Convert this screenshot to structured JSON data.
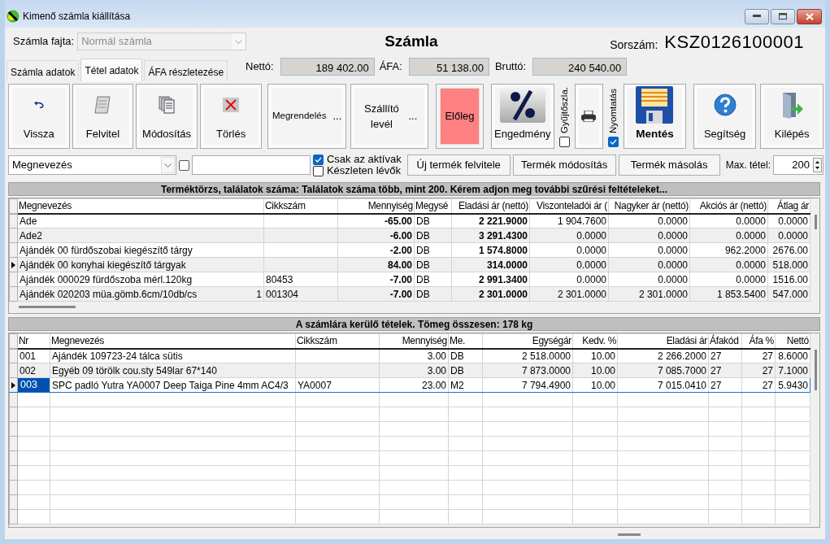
{
  "window": {
    "title": "Kimenő számla kiállítása"
  },
  "header": {
    "type_label": "Számla fajta:",
    "type_value": "Normál számla",
    "type_disabled": true,
    "title": "Számla",
    "number_label": "Sorszám:",
    "number": "KSZ0126100001"
  },
  "tabs": [
    {
      "label": "Számla adatok",
      "selected": false
    },
    {
      "label": "Tétel adatok",
      "selected": true
    },
    {
      "label": "ÁFA részletezése",
      "selected": false
    }
  ],
  "totals": [
    {
      "label": "Nettó:",
      "value": "189 402.00"
    },
    {
      "label": "ÁFA:",
      "value": "51 138.00"
    },
    {
      "label": "Bruttó:",
      "value": "240 540.00"
    }
  ],
  "toolbar": [
    {
      "kind": "icon",
      "label": "Vissza"
    },
    {
      "kind": "icon",
      "label": "Felvitel"
    },
    {
      "kind": "icon",
      "label": "Módosítás"
    },
    {
      "kind": "icon",
      "label": "Törlés"
    },
    {
      "kind": "dots",
      "label": "Megrendelés",
      "suffix": "..."
    },
    {
      "kind": "dots",
      "label": "Szállító levél",
      "suffix": "..."
    },
    {
      "kind": "colored",
      "label": "Előleg",
      "color": "#ff8080"
    },
    {
      "kind": "icon",
      "label": "Engedmény"
    },
    {
      "kind": "vcheck",
      "label": "Gyűjtőszla.",
      "checked": false
    },
    {
      "kind": "iconOnly"
    },
    {
      "kind": "vcheck",
      "label": "Nyomtatás",
      "checked": true
    },
    {
      "kind": "icon",
      "label": "Mentés",
      "emphasis": true
    },
    {
      "kind": "icon",
      "label": "Segítség"
    },
    {
      "kind": "icon",
      "label": "Kilépés"
    }
  ],
  "filter": {
    "field_value": "Megnevezés",
    "checkbox_checked": false,
    "options": [
      {
        "label": "Csak az aktívak",
        "checked": true
      },
      {
        "label": "Készleten lévők",
        "checked": false
      }
    ],
    "buttons": [
      "Új termék felvitele",
      "Termék módosítás",
      "Termék másolás"
    ],
    "max_label": "Max. tétel:",
    "max_value": "200"
  },
  "product_grid": {
    "caption": "Terméktörzs, találatok száma: Találatok száma több, mint 200. Kérem adjon meg további szűrési feltételeket...",
    "columns": [
      "Megnevezés",
      "Cikkszám",
      "Mennyiség",
      "Megysé",
      "Eladási ár (nettó)",
      "Viszonteladói ár (",
      "Nagyker ár (nettó)",
      "Akciós ár (nettó)",
      "Átlag ár"
    ],
    "rows": [
      {
        "selected": false,
        "cells": [
          "Ade",
          "",
          "-65.00",
          "DB",
          "2 221.9000",
          "1 904.7600",
          "0.0000",
          "0.0000",
          "0.0000"
        ]
      },
      {
        "selected": false,
        "cells": [
          "Ade2",
          "",
          "-6.00",
          "DB",
          "3 291.4300",
          "0.0000",
          "0.0000",
          "0.0000",
          "0.0000"
        ]
      },
      {
        "selected": false,
        "cells": [
          "Ajándék 00 fürdőszobai kiegészítő tárgy",
          "",
          "-2.00",
          "DB",
          "1 574.8000",
          "0.0000",
          "0.0000",
          "962.2000",
          "2676.00"
        ]
      },
      {
        "selected": true,
        "cells": [
          "Ajándék 00 konyhai kiegészítő tárgyak",
          "",
          "84.00",
          "DB",
          "314.0000",
          "0.0000",
          "0.0000",
          "0.0000",
          "518.000"
        ]
      },
      {
        "selected": false,
        "cells": [
          "Ajándék 000029 fürdőszoba mérl.120kg",
          "80453",
          "-7.00",
          "DB",
          "2 991.3400",
          "0.0000",
          "0.0000",
          "0.0000",
          "1516.00"
        ]
      },
      {
        "selected": false,
        "note": "1",
        "cells": [
          "Ajándék 020203 müa.gömb.6cm/10db/cs",
          "001304",
          "-7.00",
          "DB",
          "2 301.0000",
          "2 301.0000",
          "2 301.0000",
          "1 853.5400",
          "547.000"
        ]
      }
    ]
  },
  "invoice_grid": {
    "caption": "A számlára kerülő tételek. Tömeg összesen: 178 kg",
    "columns": [
      "Nr",
      "Megnevezés",
      "Cikkszám",
      "Mennyiség",
      "Me.",
      "Egységár",
      "Kedv. %",
      "Eladási ár",
      "Áfakód",
      "Áfa %",
      "Nettó"
    ],
    "rows": [
      {
        "selected": false,
        "cells": [
          "001",
          "Ajándék 109723-24 tálca sütis",
          "",
          "3.00",
          "DB",
          "2 518.0000",
          "10.00",
          "2 266.2000",
          "27",
          "27",
          "8.6000"
        ]
      },
      {
        "selected": false,
        "cells": [
          "002",
          "Egyéb 09 törölk cou.sty 549lar 67*140",
          "",
          "3.00",
          "DB",
          "7 873.0000",
          "10.00",
          "7 085.7000",
          "27",
          "27",
          "7.1000"
        ]
      },
      {
        "selected": true,
        "cells": [
          "003",
          "SPC padló Yutra YA0007 Deep Taiga Pine 4mm AC4/3",
          "YA0007",
          "23.00",
          "M2",
          "7 794.4900",
          "10.00",
          "7 015.0410",
          "27",
          "27",
          "5.9430"
        ]
      }
    ]
  }
}
